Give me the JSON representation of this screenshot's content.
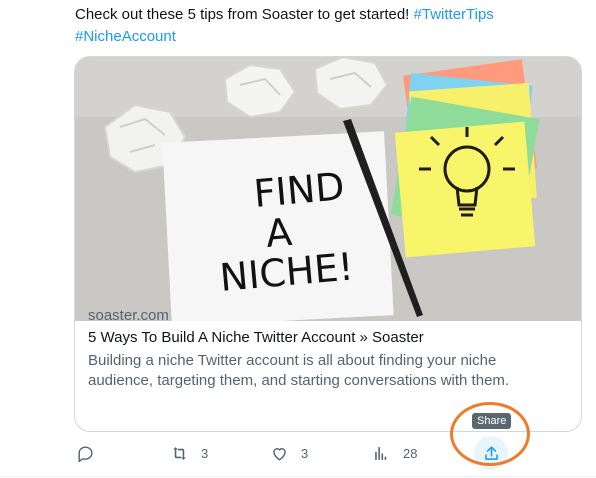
{
  "tweet": {
    "text": "Check out these 5 tips from Soaster to get started! ",
    "hashtags": [
      "#TwitterTips",
      "#NicheAccount"
    ]
  },
  "card": {
    "image_text": [
      "FIND",
      "A",
      "NICHE!"
    ],
    "domain": "soaster.com",
    "title": "5 Ways To Build A Niche Twitter Account » Soaster",
    "description": "Building a niche Twitter account is all about finding your niche audience, targeting them, and starting conversations with them."
  },
  "actions": {
    "reply": {
      "icon": "reply-icon"
    },
    "retweet": {
      "icon": "retweet-icon",
      "count": "3"
    },
    "like": {
      "icon": "heart-icon",
      "count": "3"
    },
    "views": {
      "icon": "analytics-icon",
      "count": "28"
    },
    "share": {
      "icon": "share-icon",
      "tooltip": "Share"
    }
  },
  "colors": {
    "accent": "#1d9bf0",
    "highlight": "#f07a27",
    "muted_text": "#536471"
  }
}
